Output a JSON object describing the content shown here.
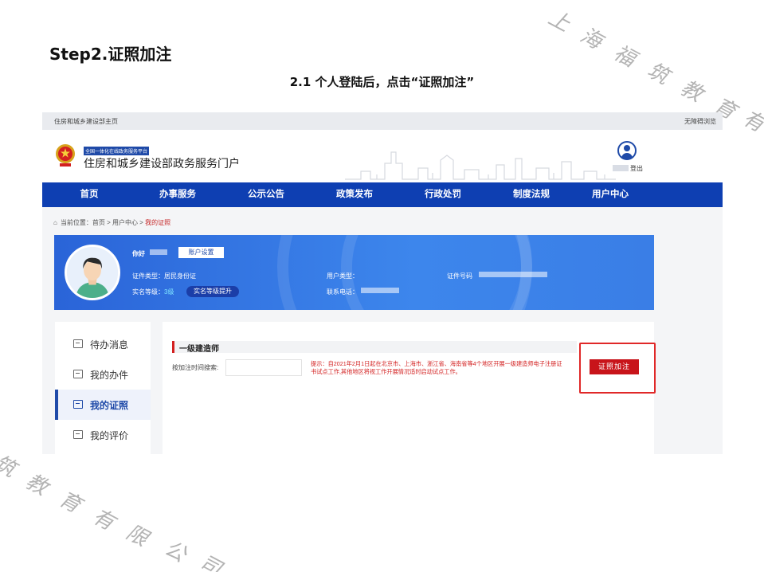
{
  "slide": {
    "title": "Step2.证照加注",
    "subtitle": "2.1   个人登陆后，点击“证照加注”",
    "watermark_top": [
      "上",
      "海",
      "福",
      "筑",
      "教",
      "育",
      "有"
    ],
    "watermark_bottom": [
      "筑",
      "教",
      "育",
      "有",
      "限",
      "公",
      "司"
    ]
  },
  "topstrip": {
    "left": "住房和城乡建设部主页",
    "right": "无障碍浏览"
  },
  "banner": {
    "platform_tag": "全国一体化在线政务服务平台",
    "portal_name": "住房和城乡建设部政务服务门户",
    "login": "登出"
  },
  "nav": [
    "首页",
    "办事服务",
    "公示公告",
    "政策发布",
    "行政处罚",
    "制度法规",
    "用户中心"
  ],
  "breadcrumb": {
    "prefix": "当前位置：首页 > 用户中心 > ",
    "current": "我的证照"
  },
  "profile": {
    "hello": "你好",
    "account_settings": "账户设置",
    "id_type": "证件类型：居民身份证",
    "level_prefix": "实名等级：",
    "level_value": "3级",
    "upgrade": "实名等级提升",
    "user_type": "用户类型：",
    "phone": "联系电话：",
    "id_number": "证件号码"
  },
  "sidebar": [
    {
      "label": "待办消息",
      "icon": "message-icon"
    },
    {
      "label": "我的办件",
      "icon": "document-icon"
    },
    {
      "label": "我的证照",
      "icon": "certificate-icon"
    },
    {
      "label": "我的评价",
      "icon": "comment-icon"
    }
  ],
  "panel": {
    "title": "一级建造师",
    "search_label": "按加注时间搜索:",
    "search_placeholder": "",
    "tip": "提示：自2021年2月1日起在北京市、上海市、浙江省、海南省等4个地区开展一级建造师电子注册证书试点工作,其他地区将视工作开展情况适时启动试点工作。",
    "button": "证照加注"
  },
  "colors": {
    "nav": "#0e3fb2",
    "accent_red": "#c8141a",
    "highlight": "#e02828"
  }
}
